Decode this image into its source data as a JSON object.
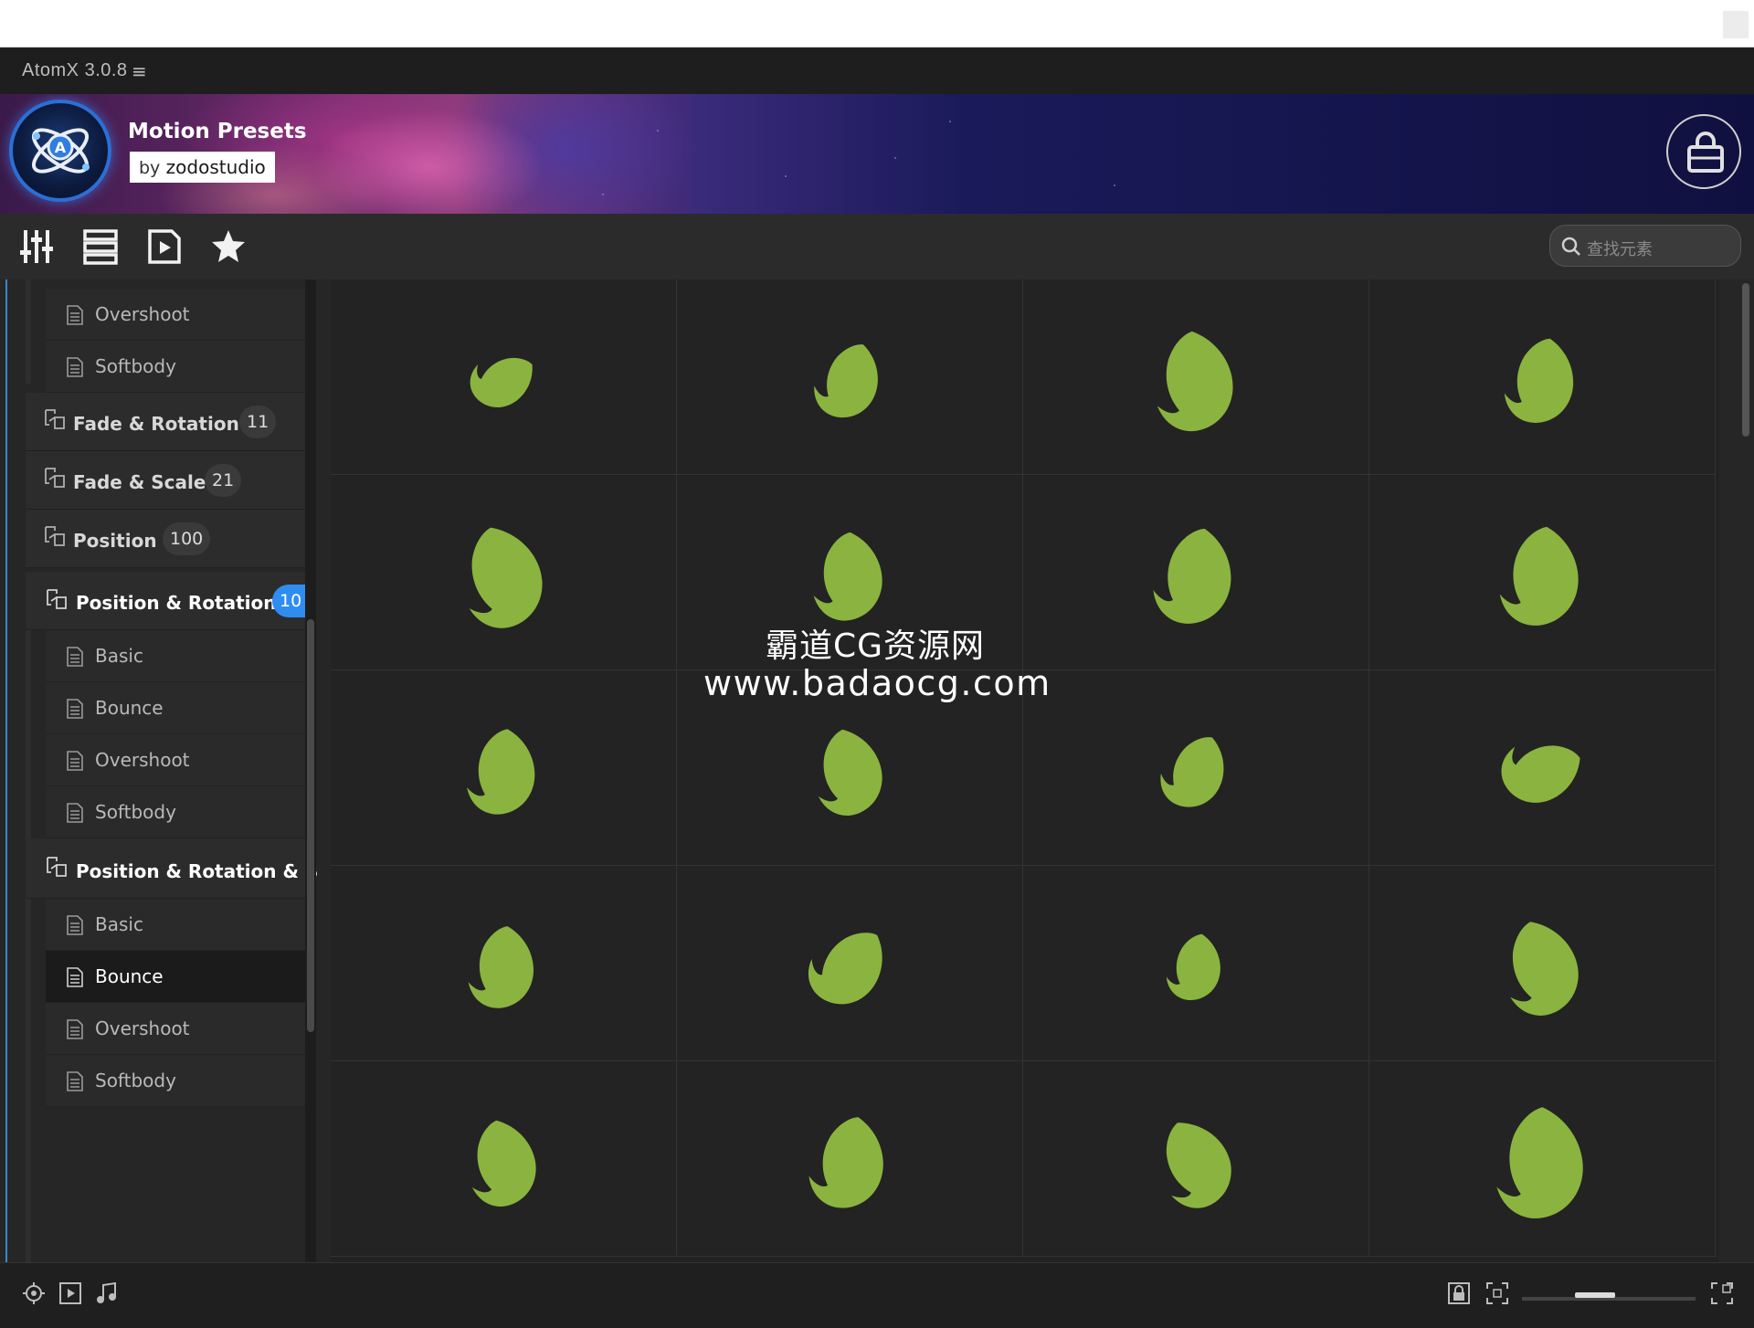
{
  "app": {
    "title": "AtomX 3.0.8",
    "menu_glyph": "≡"
  },
  "banner": {
    "title": "Motion Presets",
    "by_prefix": "by",
    "by_author": "zodostudio"
  },
  "search": {
    "placeholder": "查找元素"
  },
  "sidebar": {
    "top_children": [
      "Overshoot",
      "Softbody"
    ],
    "categories": [
      {
        "label": "Fade & Rotation",
        "count": "11"
      },
      {
        "label": "Fade & Scale",
        "count": "21"
      },
      {
        "label": "Position",
        "count": "100"
      }
    ],
    "open_category_1": {
      "label": "Position & Rotation",
      "count": "10",
      "children": [
        "Basic",
        "Bounce",
        "Overshoot",
        "Softbody"
      ]
    },
    "open_category_2": {
      "label": "Position & Rotation & Sc",
      "children": [
        "Basic",
        "Bounce",
        "Overshoot",
        "Softbody"
      ],
      "active_child": "Bounce"
    }
  },
  "grid": {
    "columns": 4,
    "rows": 5,
    "leaf_color": "#8ab43f"
  },
  "watermark": {
    "line1": "霸道CG资源网",
    "line2": "www.badaocg.com"
  },
  "colors": {
    "accent": "#2f8df0",
    "leaf": "#8ab43f",
    "background": "#262626"
  }
}
